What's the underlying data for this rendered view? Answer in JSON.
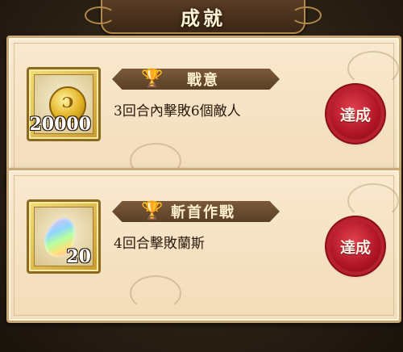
{
  "header": {
    "title": "成就"
  },
  "achievements": [
    {
      "name": "戰意",
      "description": "3回合內擊敗6個敵人",
      "reward_type": "coin",
      "reward_quantity": "20000",
      "status": "達成",
      "icon": "gold-coin-icon"
    },
    {
      "name": "斬首作戰",
      "description": "4回合擊敗蘭斯",
      "reward_type": "gem",
      "reward_quantity": "20",
      "status": "達成",
      "icon": "rainbow-gem-icon"
    }
  ],
  "colors": {
    "seal_red": "#b01525",
    "card_bg": "#f6e4c4",
    "banner_brown": "#5a3f26",
    "trophy_gold": "#f0c445"
  }
}
